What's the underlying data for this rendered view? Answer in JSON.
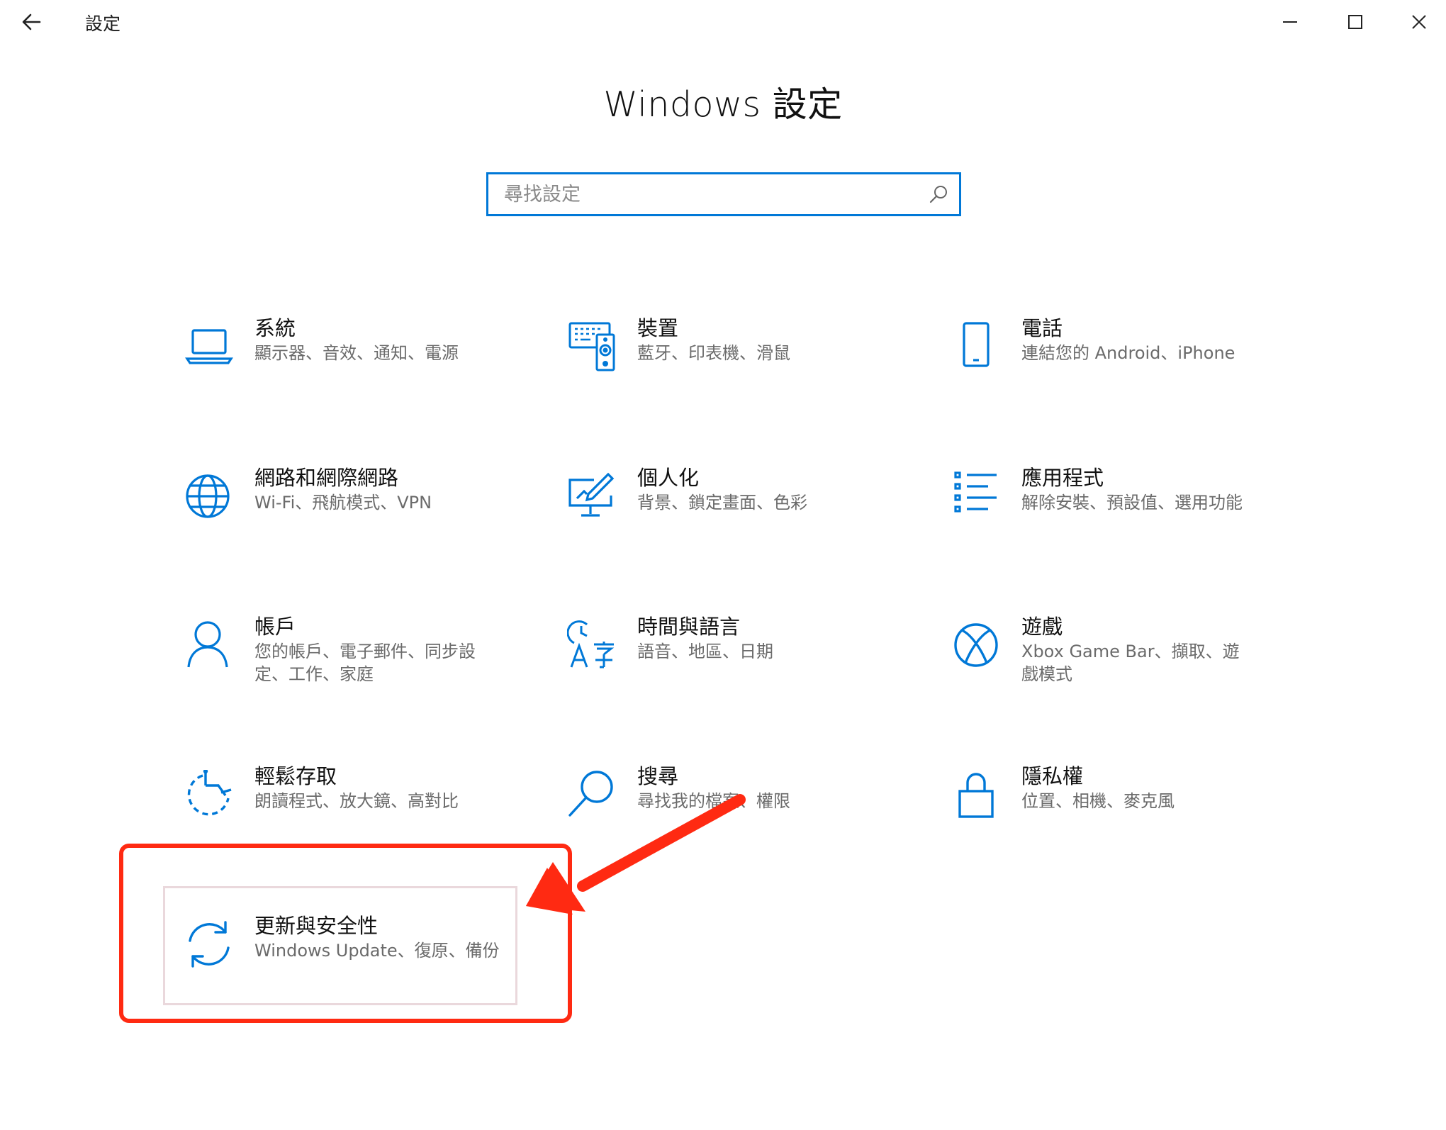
{
  "titlebar": {
    "back_icon": "back-arrow-icon",
    "title": "設定",
    "minimize_icon": "minimize-icon",
    "maximize_icon": "maximize-icon",
    "close_icon": "close-icon"
  },
  "heading": "Windows 設定",
  "search": {
    "placeholder": "尋找設定",
    "value": "",
    "icon": "search-icon"
  },
  "accent_color": "#0078d7",
  "annotation_color": "#ff2a12",
  "tiles": [
    {
      "title": "系統",
      "desc": "顯示器、音效、通知、電源",
      "icon": "laptop-icon"
    },
    {
      "title": "裝置",
      "desc": "藍牙、印表機、滑鼠",
      "icon": "devices-icon"
    },
    {
      "title": "電話",
      "desc": "連結您的 Android、iPhone",
      "icon": "phone-icon"
    },
    {
      "title": "網路和網際網路",
      "desc": "Wi-Fi、飛航模式、VPN",
      "icon": "globe-icon"
    },
    {
      "title": "個人化",
      "desc": "背景、鎖定畫面、色彩",
      "icon": "personalization-icon"
    },
    {
      "title": "應用程式",
      "desc": "解除安裝、預設值、選用功能",
      "icon": "apps-list-icon"
    },
    {
      "title": "帳戶",
      "desc": "您的帳戶、電子郵件、同步設定、工作、家庭",
      "icon": "person-icon"
    },
    {
      "title": "時間與語言",
      "desc": "語音、地區、日期",
      "icon": "time-language-icon"
    },
    {
      "title": "遊戲",
      "desc": "Xbox Game Bar、擷取、遊戲模式",
      "icon": "xbox-icon"
    },
    {
      "title": "輕鬆存取",
      "desc": "朗讀程式、放大鏡、高對比",
      "icon": "ease-of-access-icon"
    },
    {
      "title": "搜尋",
      "desc": "尋找我的檔案、權限",
      "icon": "magnifier-icon"
    },
    {
      "title": "隱私權",
      "desc": "位置、相機、麥克風",
      "icon": "lock-icon"
    },
    {
      "title": "更新與安全性",
      "desc": "Windows Update、復原、備份",
      "icon": "update-sync-icon"
    }
  ]
}
